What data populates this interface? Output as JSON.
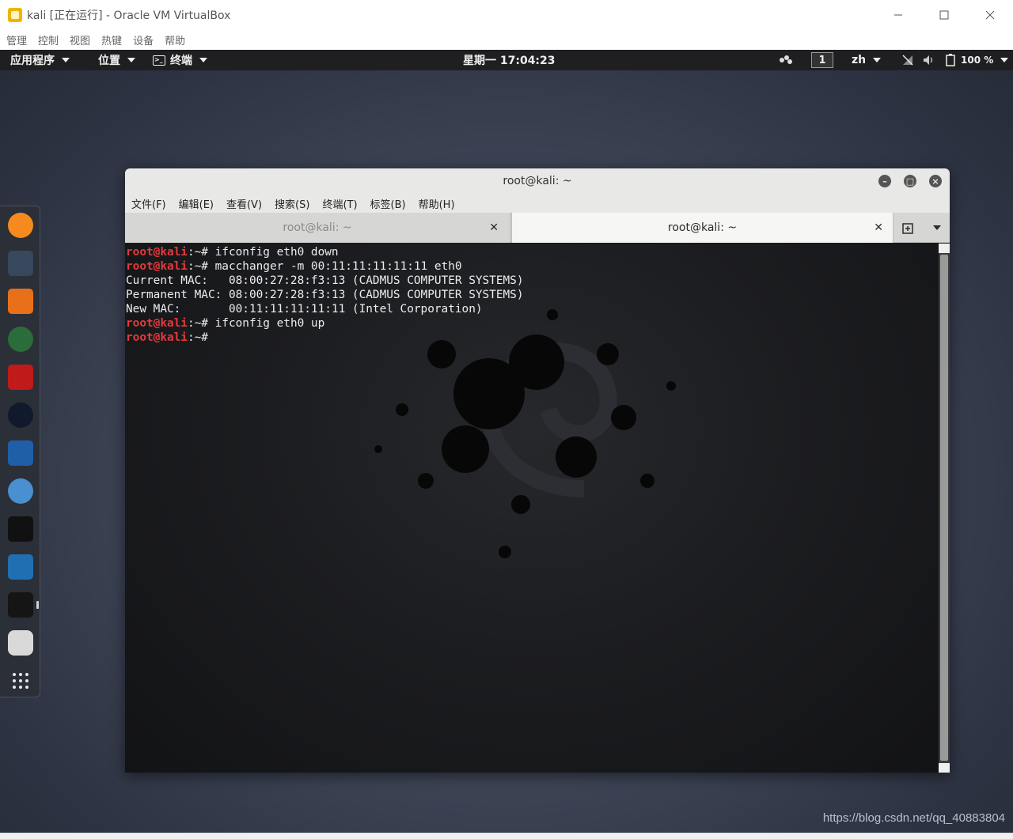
{
  "host": {
    "title": "kali [正在运行] - Oracle VM VirtualBox",
    "menu": [
      "管理",
      "控制",
      "视图",
      "热键",
      "设备",
      "帮助"
    ]
  },
  "topbar": {
    "applications": "应用程序",
    "places": "位置",
    "terminal": "终端",
    "clock": "星期一 17:04:23",
    "workspace": "1",
    "input_method": "zh",
    "battery": "100 %"
  },
  "dock": {
    "items": [
      "firefox-icon",
      "aircrack-icon",
      "burpsuite-icon",
      "maltego-icon",
      "john-icon",
      "faraday-icon",
      "metasploit-icon",
      "armitage-icon",
      "beef-icon",
      "wireshark-icon",
      "terminal-icon",
      "chromium-icon",
      "show-applications-icon"
    ]
  },
  "terminal": {
    "title": "root@kali: ~",
    "menu": [
      "文件(F)",
      "编辑(E)",
      "查看(V)",
      "搜索(S)",
      "终端(T)",
      "标签(B)",
      "帮助(H)"
    ],
    "tabs": [
      {
        "label": "root@kali: ~",
        "active": false
      },
      {
        "label": "root@kali: ~",
        "active": true
      }
    ],
    "prompt_user": "root@kali",
    "prompt_rest": ":~# ",
    "lines": [
      {
        "type": "cmd",
        "text": "ifconfig eth0 down"
      },
      {
        "type": "cmd",
        "text": "macchanger -m 00:11:11:11:11:11 eth0"
      },
      {
        "type": "out",
        "text": "Current MAC:   08:00:27:28:f3:13 (CADMUS COMPUTER SYSTEMS)"
      },
      {
        "type": "out",
        "text": "Permanent MAC: 08:00:27:28:f3:13 (CADMUS COMPUTER SYSTEMS)"
      },
      {
        "type": "out",
        "text": "New MAC:       00:11:11:11:11:11 (Intel Corporation)"
      },
      {
        "type": "cmd",
        "text": "ifconfig eth0 up"
      },
      {
        "type": "cmd",
        "text": ""
      }
    ]
  },
  "watermark": "https://blog.csdn.net/qq_40883804",
  "colors": {
    "prompt": "#e3393b",
    "terminal_bg": "#1a1b1e",
    "topbar_bg": "#1f1f21"
  }
}
